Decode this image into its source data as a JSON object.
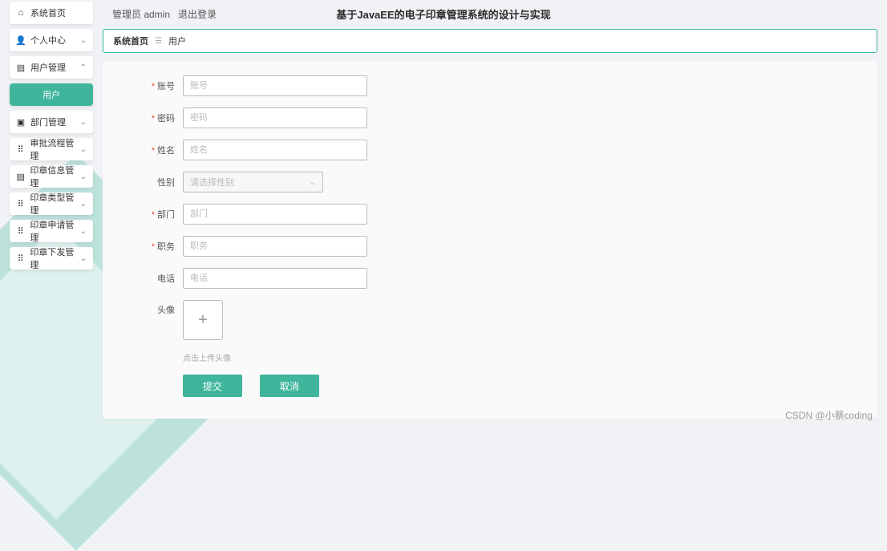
{
  "header": {
    "title": "基于JavaEE的电子印章管理系统的设计与实现",
    "role_label": "管理员 admin",
    "logout_label": "退出登录"
  },
  "sidebar": {
    "items": [
      {
        "icon": "home",
        "label": "系统首页",
        "expandable": false
      },
      {
        "icon": "person",
        "label": "个人中心",
        "expandable": true
      },
      {
        "icon": "users",
        "label": "用户管理",
        "expandable": true,
        "expanded": true
      },
      {
        "icon": "",
        "label": "用户",
        "active": true
      },
      {
        "icon": "dept",
        "label": "部门管理",
        "expandable": true
      },
      {
        "icon": "flow",
        "label": "审批流程管理",
        "expandable": true
      },
      {
        "icon": "info",
        "label": "印章信息管理",
        "expandable": true
      },
      {
        "icon": "type",
        "label": "印章类型管理",
        "expandable": true
      },
      {
        "icon": "apply",
        "label": "印章申请管理",
        "expandable": true
      },
      {
        "icon": "send",
        "label": "印章下发管理",
        "expandable": true
      }
    ]
  },
  "breadcrumb": {
    "home": "系统首页",
    "current": "用户"
  },
  "form": {
    "fields": {
      "account": {
        "label": "账号",
        "placeholder": "账号",
        "required": true
      },
      "password": {
        "label": "密码",
        "placeholder": "密码",
        "required": true
      },
      "name": {
        "label": "姓名",
        "placeholder": "姓名",
        "required": true
      },
      "gender": {
        "label": "性别",
        "placeholder": "请选择性别",
        "required": false
      },
      "dept": {
        "label": "部门",
        "placeholder": "部门",
        "required": true
      },
      "position": {
        "label": "职务",
        "placeholder": "职务",
        "required": true
      },
      "phone": {
        "label": "电话",
        "placeholder": "电话",
        "required": false
      },
      "avatar": {
        "label": "头像",
        "hint": "点击上传头像"
      }
    },
    "buttons": {
      "submit": "提交",
      "cancel": "取消"
    }
  },
  "watermark": "CSDN @小蔡coding",
  "colors": {
    "accent": "#3fb59b"
  }
}
